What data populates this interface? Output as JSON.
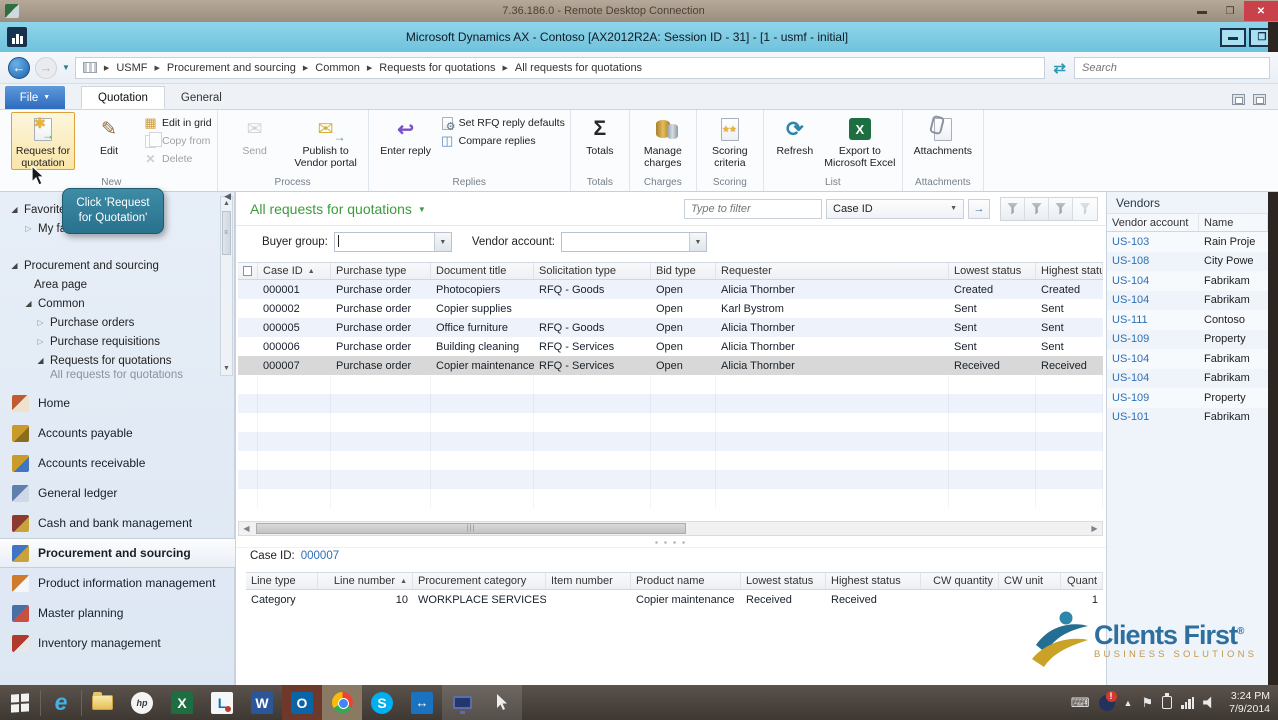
{
  "rdp_bar": {
    "title": "7.36.186.0 - Remote Desktop Connection"
  },
  "title_bar": {
    "title": "Microsoft Dynamics AX - Contoso [AX2012R2A: Session ID - 31] -  [1 - usmf - initial]"
  },
  "address_bar": {
    "breadcrumb": [
      "USMF",
      "Procurement and sourcing",
      "Common",
      "Requests for quotations",
      "All requests for quotations"
    ],
    "search_placeholder": "Search"
  },
  "tab_strip": {
    "file_label": "File",
    "tabs": [
      "Quotation",
      "General"
    ]
  },
  "ribbon": {
    "groups": [
      {
        "label": "New",
        "large": [
          {
            "label": "Request for quotation"
          },
          {
            "label": "Edit"
          }
        ],
        "small": [
          {
            "label": "Edit in grid"
          },
          {
            "label": "Copy from"
          },
          {
            "label": "Delete"
          }
        ]
      },
      {
        "label": "Process",
        "large": [
          {
            "label": "Send"
          },
          {
            "label": "Publish to Vendor portal"
          }
        ],
        "small": []
      },
      {
        "label": "Replies",
        "large": [
          {
            "label": "Enter reply"
          }
        ],
        "small": [
          {
            "label": "Set RFQ reply defaults"
          },
          {
            "label": "Compare replies"
          }
        ]
      },
      {
        "label": "Totals",
        "large": [
          {
            "label": "Totals"
          }
        ],
        "small": []
      },
      {
        "label": "Charges",
        "large": [
          {
            "label": "Manage charges"
          }
        ],
        "small": []
      },
      {
        "label": "Scoring",
        "large": [
          {
            "label": "Scoring criteria"
          }
        ],
        "small": []
      },
      {
        "label": "List",
        "large": [
          {
            "label": "Refresh"
          },
          {
            "label": "Export to Microsoft Excel"
          }
        ],
        "small": []
      },
      {
        "label": "Attachments",
        "large": [
          {
            "label": "Attachments"
          }
        ],
        "small": []
      }
    ]
  },
  "tooltip": {
    "text": "Click 'Request for Quotation'"
  },
  "nav": {
    "tree": [
      {
        "label": "Favorites"
      },
      {
        "label": "My favorites"
      },
      {
        "label": "Procurement and sourcing"
      },
      {
        "label": "Area page"
      },
      {
        "label": "Common"
      },
      {
        "label": "Purchase orders"
      },
      {
        "label": "Purchase requisitions"
      },
      {
        "label": "Requests for quotations"
      },
      {
        "label": "All requests for quotations"
      }
    ],
    "modules": [
      "Home",
      "Accounts payable",
      "Accounts receivable",
      "General ledger",
      "Cash and bank management",
      "Procurement and sourcing",
      "Product information management",
      "Master planning",
      "Inventory management"
    ],
    "active_module": "Procurement and sourcing"
  },
  "content": {
    "page_title": "All requests for quotations",
    "filter": {
      "placeholder": "Type to filter",
      "field": "Case ID"
    },
    "params": {
      "buyer_group_label": "Buyer group:",
      "vendor_account_label": "Vendor account:"
    },
    "grid": {
      "columns": [
        "Case ID",
        "Purchase type",
        "Document title",
        "Solicitation type",
        "Bid type",
        "Requester",
        "Lowest status",
        "Highest status"
      ],
      "rows": [
        [
          "000001",
          "Purchase order",
          "Photocopiers",
          "RFQ - Goods",
          "Open",
          "Alicia Thornber",
          "Created",
          "Created"
        ],
        [
          "000002",
          "Purchase order",
          "Copier supplies",
          "",
          "Open",
          "Karl Bystrom",
          "Sent",
          "Sent"
        ],
        [
          "000005",
          "Purchase order",
          "Office furniture",
          "RFQ - Goods",
          "Open",
          "Alicia Thornber",
          "Sent",
          "Sent"
        ],
        [
          "000006",
          "Purchase order",
          "Building cleaning",
          "RFQ - Services",
          "Open",
          "Alicia Thornber",
          "Sent",
          "Sent"
        ],
        [
          "000007",
          "Purchase order",
          "Copier maintenance",
          "RFQ - Services",
          "Open",
          "Alicia Thornber",
          "Received",
          "Received"
        ]
      ],
      "selected_case": "000007"
    },
    "details": {
      "case_label": "Case ID:",
      "case_value": "000007",
      "columns": [
        "Line type",
        "Line number",
        "Procurement category",
        "Item number",
        "Product name",
        "Lowest status",
        "Highest status",
        "CW quantity",
        "CW unit",
        "Quant"
      ],
      "row": [
        "Category",
        "10",
        "WORKPLACE SERVICES",
        "",
        "Copier maintenance",
        "Received",
        "Received",
        "",
        "",
        "1"
      ]
    }
  },
  "factbox": {
    "title": "Vendors",
    "columns": [
      "Vendor account",
      "Name"
    ],
    "rows": [
      [
        "US-103",
        "Rain Proje"
      ],
      [
        "US-108",
        "City Powe"
      ],
      [
        "US-104",
        "Fabrikam"
      ],
      [
        "US-104",
        "Fabrikam"
      ],
      [
        "US-111",
        "Contoso"
      ],
      [
        "US-109",
        "Property"
      ],
      [
        "US-104",
        "Fabrikam"
      ],
      [
        "US-104",
        "Fabrikam"
      ],
      [
        "US-109",
        "Property"
      ],
      [
        "US-101",
        "Fabrikam"
      ]
    ]
  },
  "logo": {
    "line1": "Clients First",
    "reg": "®",
    "line2": "BUSINESS SOLUTIONS"
  },
  "taskbar": {
    "clock_time": "3:24 PM",
    "clock_date": "7/9/2014"
  },
  "colors": {
    "accent_green": "#3c9b3c",
    "link_blue": "#2e6fb5",
    "titlebar_blue": "#7fcde4",
    "tooltip_teal": "#2d7f98",
    "selection_gray": "#d8d8d8"
  }
}
